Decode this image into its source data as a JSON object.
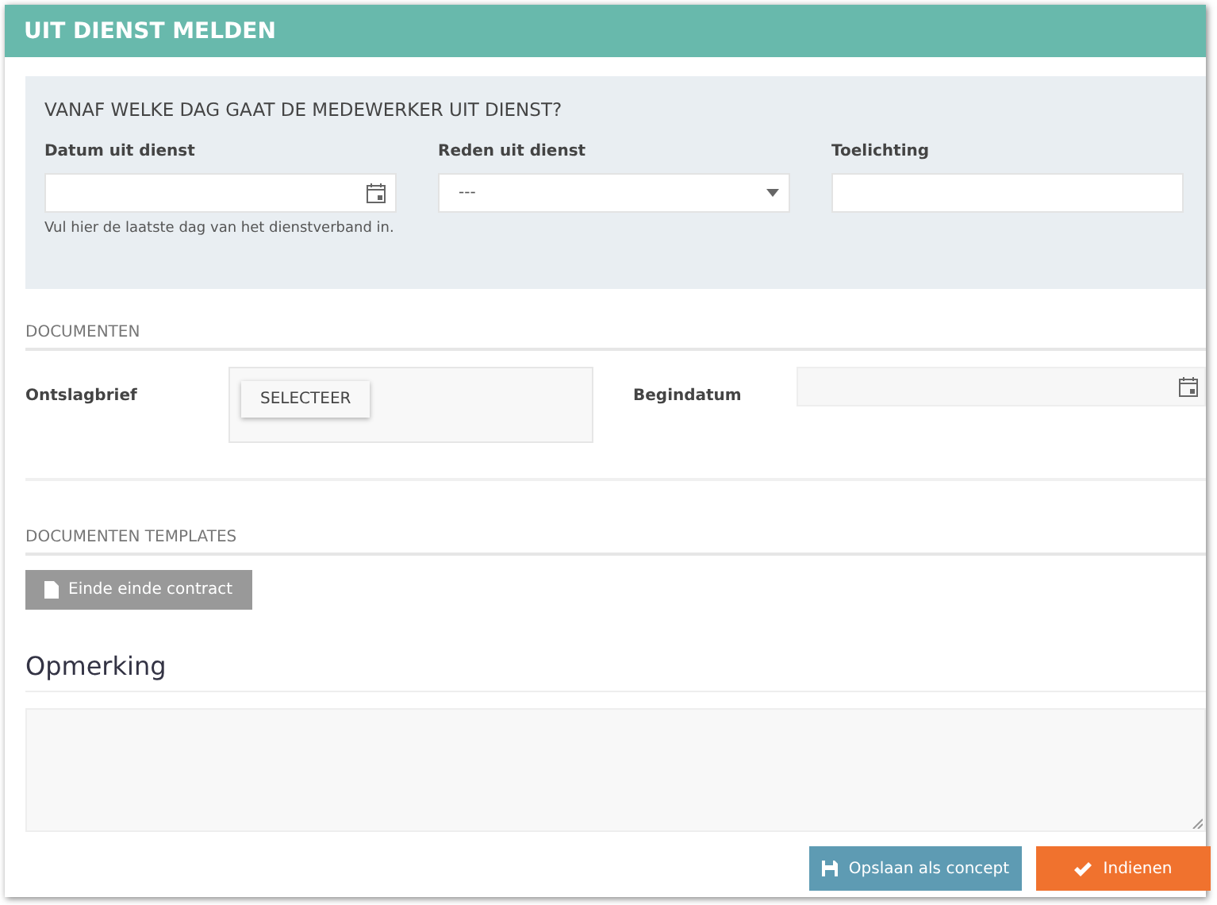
{
  "window": {
    "title": "UIT DIENST MELDEN"
  },
  "question_panel": {
    "heading": "VANAF WELKE DAG GAAT DE MEDEWERKER UIT DIENST?",
    "fields": [
      {
        "kind": "date",
        "label": "Datum uit dienst",
        "hint": "Vul hier de laatste dag van het dienstverband in."
      },
      {
        "kind": "select",
        "label": "Reden uit dienst",
        "value": "---"
      },
      {
        "kind": "text",
        "label": "Toelichting"
      }
    ]
  },
  "documents": {
    "heading": "DOCUMENTEN",
    "file_label": "Ontslagbrief",
    "file_button": "SELECTEER",
    "date_label": "Begindatum"
  },
  "templates": {
    "heading": "DOCUMENTEN TEMPLATES",
    "buttons": [
      "Einde einde contract"
    ]
  },
  "remark": {
    "heading": "Opmerking"
  },
  "footer": {
    "save_button": "Opslaan als concept",
    "submit_button": "Indienen"
  }
}
